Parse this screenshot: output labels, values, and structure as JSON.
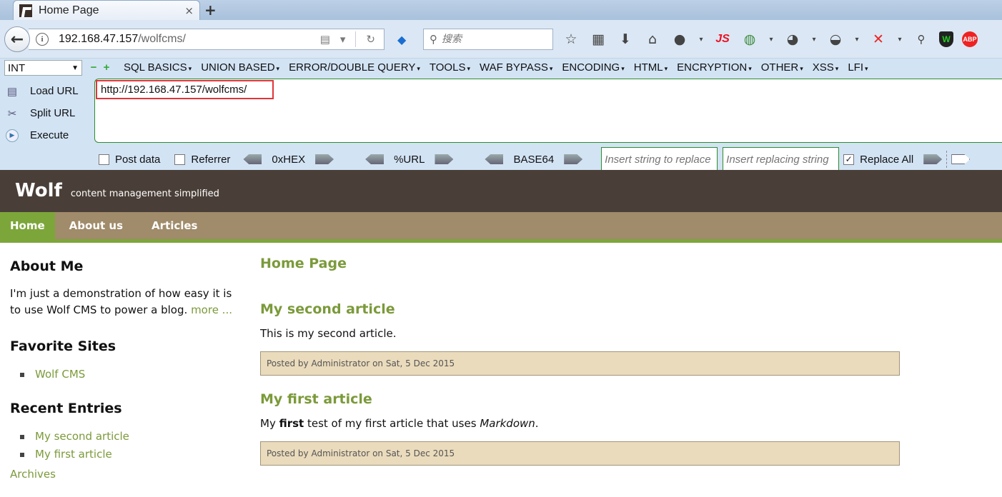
{
  "browser": {
    "tab_title": "Home Page",
    "tab_close": "×",
    "new_tab": "+",
    "url_host": "192.168.47.157",
    "url_path": "/wolfcms/",
    "search_placeholder": "搜索",
    "js_label": "JS",
    "abp_label": "ABP"
  },
  "hackbar": {
    "select_value": "INT",
    "menu_items": [
      "SQL BASICS",
      "UNION BASED",
      "ERROR/DOUBLE QUERY",
      "TOOLS",
      "WAF BYPASS",
      "ENCODING",
      "HTML",
      "ENCRYPTION",
      "OTHER",
      "XSS",
      "LFI"
    ],
    "load_url": "Load URL",
    "split_url": "Split URL",
    "execute": "Execute",
    "url_value": "http://192.168.47.157/wolfcms/",
    "post_data": "Post data",
    "referrer": "Referrer",
    "hex": "0xHEX",
    "url_enc": "%URL",
    "base64": "BASE64",
    "replace_from_placeholder": "Insert string to replace",
    "replace_to_placeholder": "Insert replacing string",
    "replace_all": "Replace All",
    "replace_all_checked": "✓"
  },
  "site": {
    "logo": "Wolf",
    "slogan": "content management simplified",
    "nav": [
      "Home",
      "About us",
      "Articles"
    ],
    "sidebar": {
      "about_title": "About Me",
      "about_text": "I'm just a demonstration of how easy it is to use Wolf CMS to power a blog.",
      "more_link": "more ...",
      "fav_title": "Favorite Sites",
      "fav_items": [
        "Wolf CMS"
      ],
      "recent_title": "Recent Entries",
      "recent_items": [
        "My second article",
        "My first article"
      ],
      "archives": "Archives"
    },
    "content": {
      "page_title": "Home Page",
      "articles": [
        {
          "title": "My second article",
          "body": "This is my second article.",
          "meta": "Posted by Administrator on Sat, 5 Dec 2015"
        },
        {
          "title": "My first article",
          "body_prefix": "My ",
          "body_bold": "first",
          "body_middle": " test of my first article that uses ",
          "body_italic": "Markdown",
          "body_suffix": ".",
          "meta": "Posted by Administrator on Sat, 5 Dec 2015"
        }
      ]
    }
  }
}
